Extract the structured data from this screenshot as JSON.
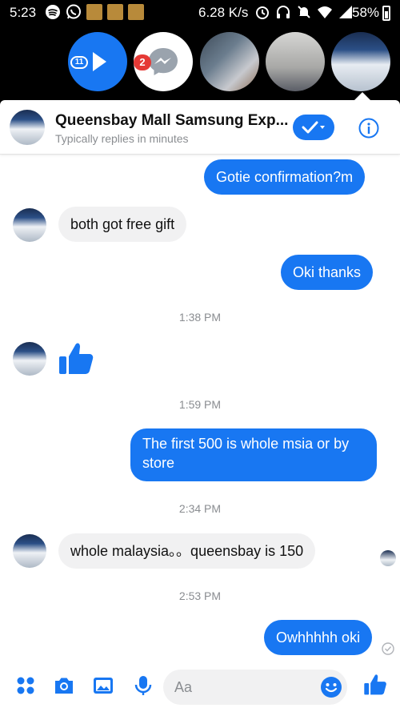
{
  "status_bar": {
    "time": "5:23",
    "net_speed": "6.28 K/s",
    "battery": "58%"
  },
  "chat_heads": {
    "play_badge": "11",
    "messenger_badge": "2"
  },
  "chat": {
    "title": "Queensbay Mall Samsung Exp...",
    "subtitle": "Typically replies in minutes",
    "composer_placeholder": "Aa"
  },
  "messages": [
    {
      "type": "out",
      "text": "Gotie confirmation?m"
    },
    {
      "type": "in",
      "text": "both got free gift"
    },
    {
      "type": "out",
      "text": "Oki thanks"
    },
    {
      "type": "timestamp",
      "text": "1:38 PM"
    },
    {
      "type": "in-like"
    },
    {
      "type": "timestamp",
      "text": "1:59 PM"
    },
    {
      "type": "out",
      "text": "The first 500 is whole msia or by store"
    },
    {
      "type": "timestamp",
      "text": "2:34 PM"
    },
    {
      "type": "in",
      "text": "whole malaysia。。queensbay is 150"
    },
    {
      "type": "timestamp",
      "text": "2:53 PM"
    },
    {
      "type": "out",
      "text": "Owhhhhh oki"
    }
  ],
  "colors": {
    "accent": "#1877f2",
    "incoming_bubble": "#f1f1f2",
    "timestamp": "#8a8d91",
    "badge_red": "#e53935"
  },
  "icons": [
    "spotify-icon",
    "whatsapp-icon",
    "photo-icon",
    "alarm-icon",
    "headset-icon",
    "mute-icon",
    "wifi-icon",
    "signal-icon",
    "battery-icon",
    "play-icon",
    "messenger-icon",
    "check-dropdown-icon",
    "info-icon",
    "like-icon",
    "apps-icon",
    "camera-icon",
    "image-icon",
    "mic-icon",
    "emoji-icon"
  ]
}
